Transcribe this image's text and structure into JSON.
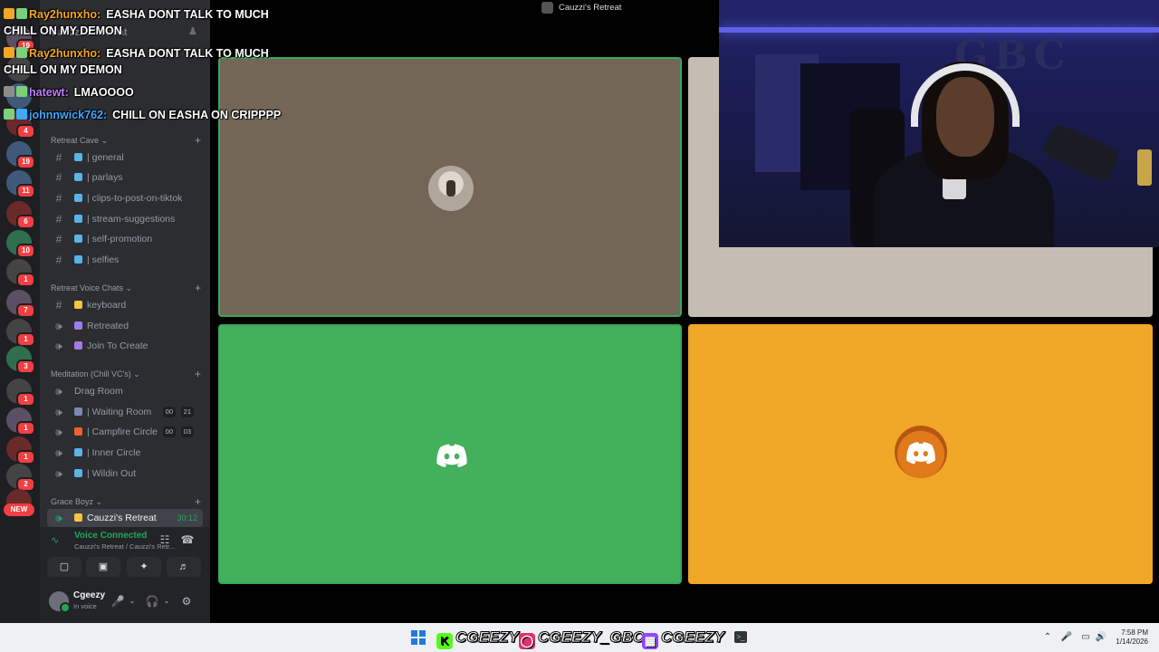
{
  "window": {
    "title": "Cauzzi's Retreat"
  },
  "server": {
    "name": "Cauzzi's Retreat"
  },
  "rail": {
    "badges": [
      "19",
      "4",
      "19",
      "11",
      "6",
      "10",
      "1",
      "7",
      "1",
      "3",
      "1",
      "1",
      "1",
      "2"
    ],
    "new_label": "NEW"
  },
  "sidebar": {
    "categories": [
      {
        "name": "Retreat Cave"
      },
      {
        "name": "Retreat Voice Chats"
      },
      {
        "name": "Meditation (Chill VC's)"
      },
      {
        "name": "Grace Boyz"
      }
    ],
    "text_channels": [
      {
        "name": "| general"
      },
      {
        "name": "| parlays"
      },
      {
        "name": "| clips-to-post-on-tiktok"
      },
      {
        "name": "| stream-suggestions"
      },
      {
        "name": "| self-promotion"
      },
      {
        "name": "| selfies"
      }
    ],
    "voice_channels": [
      {
        "name": "keyboard"
      },
      {
        "name": "Retreated"
      },
      {
        "name": "Join To Create"
      }
    ],
    "meditation_channels": [
      {
        "name": "Drag Room"
      },
      {
        "name": "| Waiting Room",
        "count_a": "00",
        "count_b": "21"
      },
      {
        "name": "| Campfire Circle",
        "count_a": "00",
        "count_b": "03"
      },
      {
        "name": "| Inner Circle"
      },
      {
        "name": "| Wildin Out"
      }
    ],
    "active_channel": {
      "name": "Cauzzi's Retreat",
      "timer": "30:12"
    }
  },
  "voice_panel": {
    "status": "Voice Connected",
    "path": "Cauzzi's Retreat / Cauzzi's Retr..."
  },
  "user": {
    "name": "Cgeezy",
    "status": "In voice"
  },
  "chat": [
    {
      "user": "Ray2hunxho:",
      "text": "EASHA DONT TALK TO MUCH",
      "cont": "CHILL ON MY DEMON",
      "color": "#f5a623"
    },
    {
      "user": "Ray2hunxho:",
      "text": "EASHA DONT TALK TO MUCH",
      "cont": "CHILL ON MY DEMON",
      "color": "#f5a623"
    },
    {
      "user": "hatewt:",
      "text": "LMAOOOO",
      "color": "#c17cff"
    },
    {
      "user": "johnnwick762:",
      "text": "CHILL ON EASHA ON CRIPPPP",
      "color": "#3fa8ff"
    }
  ],
  "taskbar": {
    "kick": "CGEEZY",
    "instagram": "CGEEZY_GBC",
    "twitch": "CGEEZY",
    "time": "7:58 PM",
    "date": "1/14/2026"
  },
  "colors": {
    "tile_green": "#43b05c",
    "tile_orange": "#f0a626",
    "tile_brown": "#736657",
    "tile_beige": "#c5bcb3",
    "voice_green": "#23a55a"
  }
}
